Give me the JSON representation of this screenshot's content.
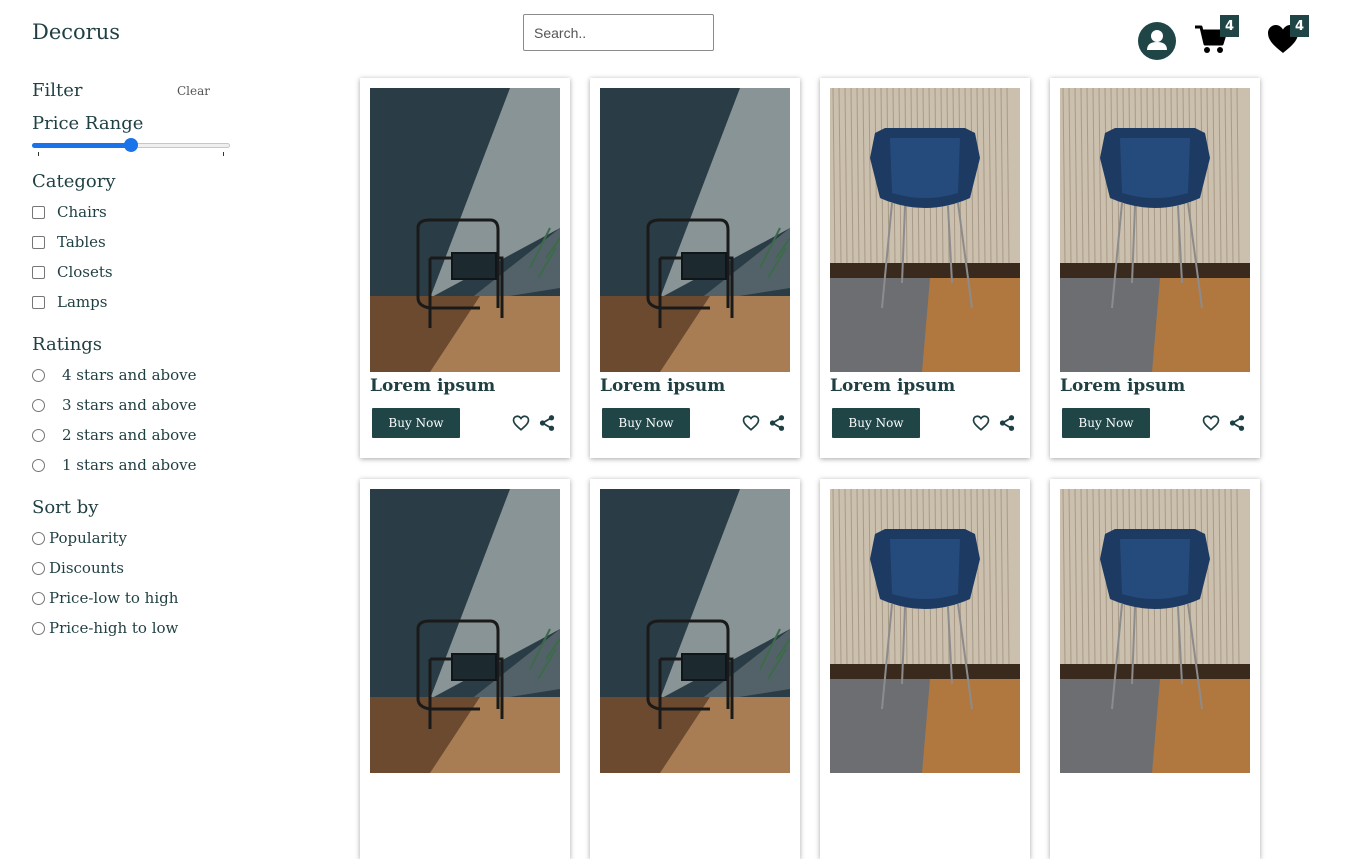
{
  "header": {
    "brand": "Decorus",
    "search_placeholder": "Search..",
    "cart_count": "4",
    "wishlist_count": "4"
  },
  "sidebar": {
    "filter_title": "Filter",
    "clear_label": "Clear",
    "price_range_title": "Price Range",
    "price_range_value": 0.5,
    "category_title": "Category",
    "categories": [
      "Chairs",
      "Tables",
      "Closets",
      "Lamps"
    ],
    "ratings_title": "Ratings",
    "ratings": [
      "4 stars and above",
      "3 stars and above",
      "2 stars and above",
      "1 stars and above"
    ],
    "sort_title": "Sort by",
    "sort_options": [
      "Popularity",
      "Discounts",
      "Price-low to high",
      "Price-high to low"
    ]
  },
  "products": [
    {
      "title": "Lorem ipsum",
      "buy_label": "Buy Now",
      "image": "dark-room-chair"
    },
    {
      "title": "Lorem ipsum",
      "buy_label": "Buy Now",
      "image": "dark-room-chair"
    },
    {
      "title": "Lorem ipsum",
      "buy_label": "Buy Now",
      "image": "blue-velvet-chair"
    },
    {
      "title": "Lorem ipsum",
      "buy_label": "Buy Now",
      "image": "blue-velvet-chair"
    },
    {
      "title": "",
      "buy_label": "",
      "image": "dark-room-chair"
    },
    {
      "title": "",
      "buy_label": "",
      "image": "dark-room-chair"
    },
    {
      "title": "",
      "buy_label": "",
      "image": "blue-velvet-chair"
    },
    {
      "title": "",
      "buy_label": "",
      "image": "blue-velvet-chair"
    }
  ],
  "colors": {
    "brand_dark": "#1f4547",
    "text": "#1f3f42",
    "slider_accent": "#1a73e8"
  }
}
